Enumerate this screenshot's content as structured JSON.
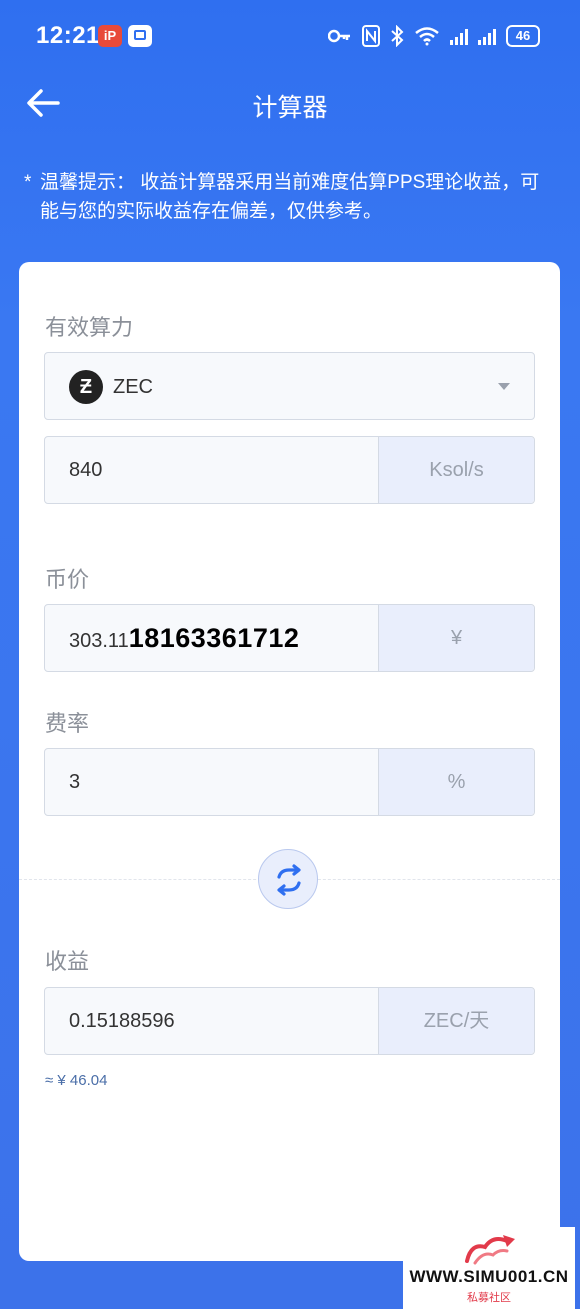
{
  "status_bar": {
    "time": "12:21",
    "app_badge_1": "iP",
    "battery": "46"
  },
  "header": {
    "title": "计算器"
  },
  "tip": {
    "star": "*",
    "text": "温馨提示： 收益计算器采用当前难度估算PPS理论收益，可能与您的实际收益存在偏差，仅供参考。"
  },
  "form": {
    "hashrate_label": "有效算力",
    "coin": {
      "icon_letter": "Ƶ",
      "name": "ZEC"
    },
    "hashrate": {
      "value": "840",
      "unit": "Ksol/s"
    },
    "price_label": "币价",
    "price": {
      "value_prefix": "303.11",
      "value_overlay": "18163361712",
      "unit": "¥"
    },
    "fee_label": "费率",
    "fee": {
      "value": "3",
      "unit": "%"
    },
    "income_label": "收益",
    "income": {
      "value": "0.15188596",
      "unit": "ZEC/天"
    },
    "approx": "≈ ¥ 46.04"
  },
  "watermark": {
    "site": "WWW.SIMU001.CN",
    "sub": "私募社区"
  },
  "colors": {
    "primary_blue": "#3a78f2",
    "unit_bg": "#e9eefc",
    "approx_text": "#4a6ea8"
  }
}
